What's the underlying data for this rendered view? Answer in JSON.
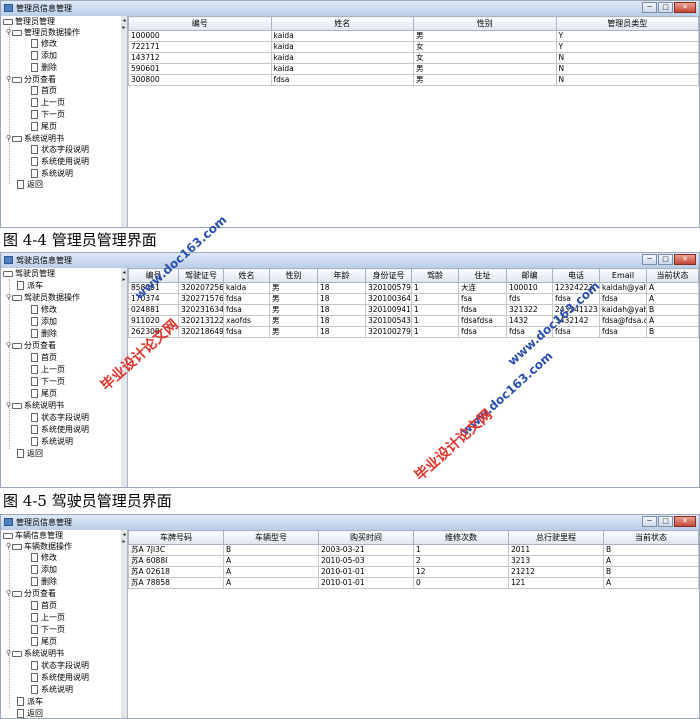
{
  "window_controls": {
    "min": "─",
    "max": "□",
    "close": "✕"
  },
  "tree_arrows": {
    "left": "◂",
    "right": "▸"
  },
  "win1": {
    "title": "管理员信息管理",
    "tree": {
      "root": "管理员管理",
      "n1": "管理员数据操作",
      "n1a": "修改",
      "n1b": "添加",
      "n1c": "删除",
      "n2": "分页查看",
      "n2a": "首页",
      "n2b": "上一页",
      "n2c": "下一页",
      "n2d": "尾页",
      "n3": "系统说明书",
      "n3a": "状态字段说明",
      "n3b": "系统使用说明",
      "n3c": "系统说明",
      "n4": "返回"
    },
    "columns": [
      "编号",
      "姓名",
      "性别",
      "管理员类型"
    ],
    "rows": [
      [
        "100000",
        "kaida",
        "男",
        "Y"
      ],
      [
        "722171",
        "kaida",
        "女",
        "Y"
      ],
      [
        "143712",
        "kaida",
        "女",
        "N"
      ],
      [
        "590601",
        "kaida",
        "男",
        "N"
      ],
      [
        "300800",
        "fdsa",
        "男",
        "N"
      ]
    ]
  },
  "caption1": "图 4-4  管理员管理界面",
  "win2": {
    "title": "驾驶员信息管理",
    "tree": {
      "root": "驾驶员管理",
      "n0": "派车",
      "n1": "驾驶员数据操作",
      "n1a": "修改",
      "n1b": "添加",
      "n1c": "删除",
      "n2": "分页查看",
      "n2a": "首页",
      "n2b": "上一页",
      "n2c": "下一页",
      "n2d": "尾页",
      "n3": "系统说明书",
      "n3a": "状态字段说明",
      "n3b": "系统使用说明",
      "n3c": "系统说明",
      "n4": "返回"
    },
    "columns": [
      "编号",
      "驾驶证号",
      "姓名",
      "性别",
      "年龄",
      "身份证号",
      "驾龄",
      "住址",
      "邮编",
      "电话",
      "Email",
      "当前状态"
    ],
    "rows": [
      [
        "858061",
        "320207256...",
        "kaida",
        "男",
        "18",
        "320100579...",
        "1",
        "大连",
        "100010",
        "12324223",
        "kaidah@yah...",
        "A"
      ],
      [
        "170374",
        "320271576...",
        "fdsa",
        "男",
        "18",
        "320100364...",
        "1",
        "fsa",
        "fds",
        "fdsa",
        "fdsa",
        "A"
      ],
      [
        "024881",
        "320231634...",
        "fdsa",
        "男",
        "18",
        "320100941...",
        "1",
        "fdsa",
        "321322",
        "243241123",
        "kaidah@yah...",
        "B"
      ],
      [
        "911020",
        "320213122...",
        "xaofds",
        "男",
        "18",
        "320100543...",
        "1",
        "fdsafdsa",
        "1432",
        "3432142",
        "fdsa@fdsa.co...",
        "A"
      ],
      [
        "262308",
        "320218649...",
        "fdsa",
        "男",
        "18",
        "320100279...",
        "1",
        "fdsa",
        "fdsa",
        "fdsa",
        "fdsa",
        "B"
      ]
    ]
  },
  "caption2": "图 4-5  驾驶员管理员界面",
  "win3": {
    "title": "管理员信息管理",
    "tree": {
      "root": "车辆信息管理",
      "n1": "车辆数据操作",
      "n1a": "修改",
      "n1b": "添加",
      "n1c": "删除",
      "n2": "分页查看",
      "n2a": "首页",
      "n2b": "上一页",
      "n2c": "下一页",
      "n2d": "尾页",
      "n3": "系统说明书",
      "n3a": "状态字段说明",
      "n3b": "系统使用说明",
      "n3c": "系统说明",
      "n5": "派车",
      "n4": "返回"
    },
    "columns": [
      "车牌号码",
      "车辆型号",
      "购买时间",
      "维修次数",
      "总行驶里程",
      "当前状态"
    ],
    "rows": [
      [
        "苏A 7Jl3C",
        "B",
        "2003-03-21",
        "1",
        "2011",
        "B"
      ],
      [
        "苏A 6088I",
        "A",
        "2010-05-03",
        "2",
        "3213",
        "A"
      ],
      [
        "苏A 02618",
        "A",
        "2010-01-01",
        "12",
        "21212",
        "B"
      ],
      [
        "苏A 78858",
        "A",
        "2010-01-01",
        "0",
        "121",
        "A"
      ]
    ]
  },
  "watermarks": {
    "red1": "毕业设计论文网",
    "blue1": "www.doc163.com",
    "red2": "毕业设计论文网",
    "blue2": "www.doc163.com",
    "blue3": "www.doc163.com"
  }
}
